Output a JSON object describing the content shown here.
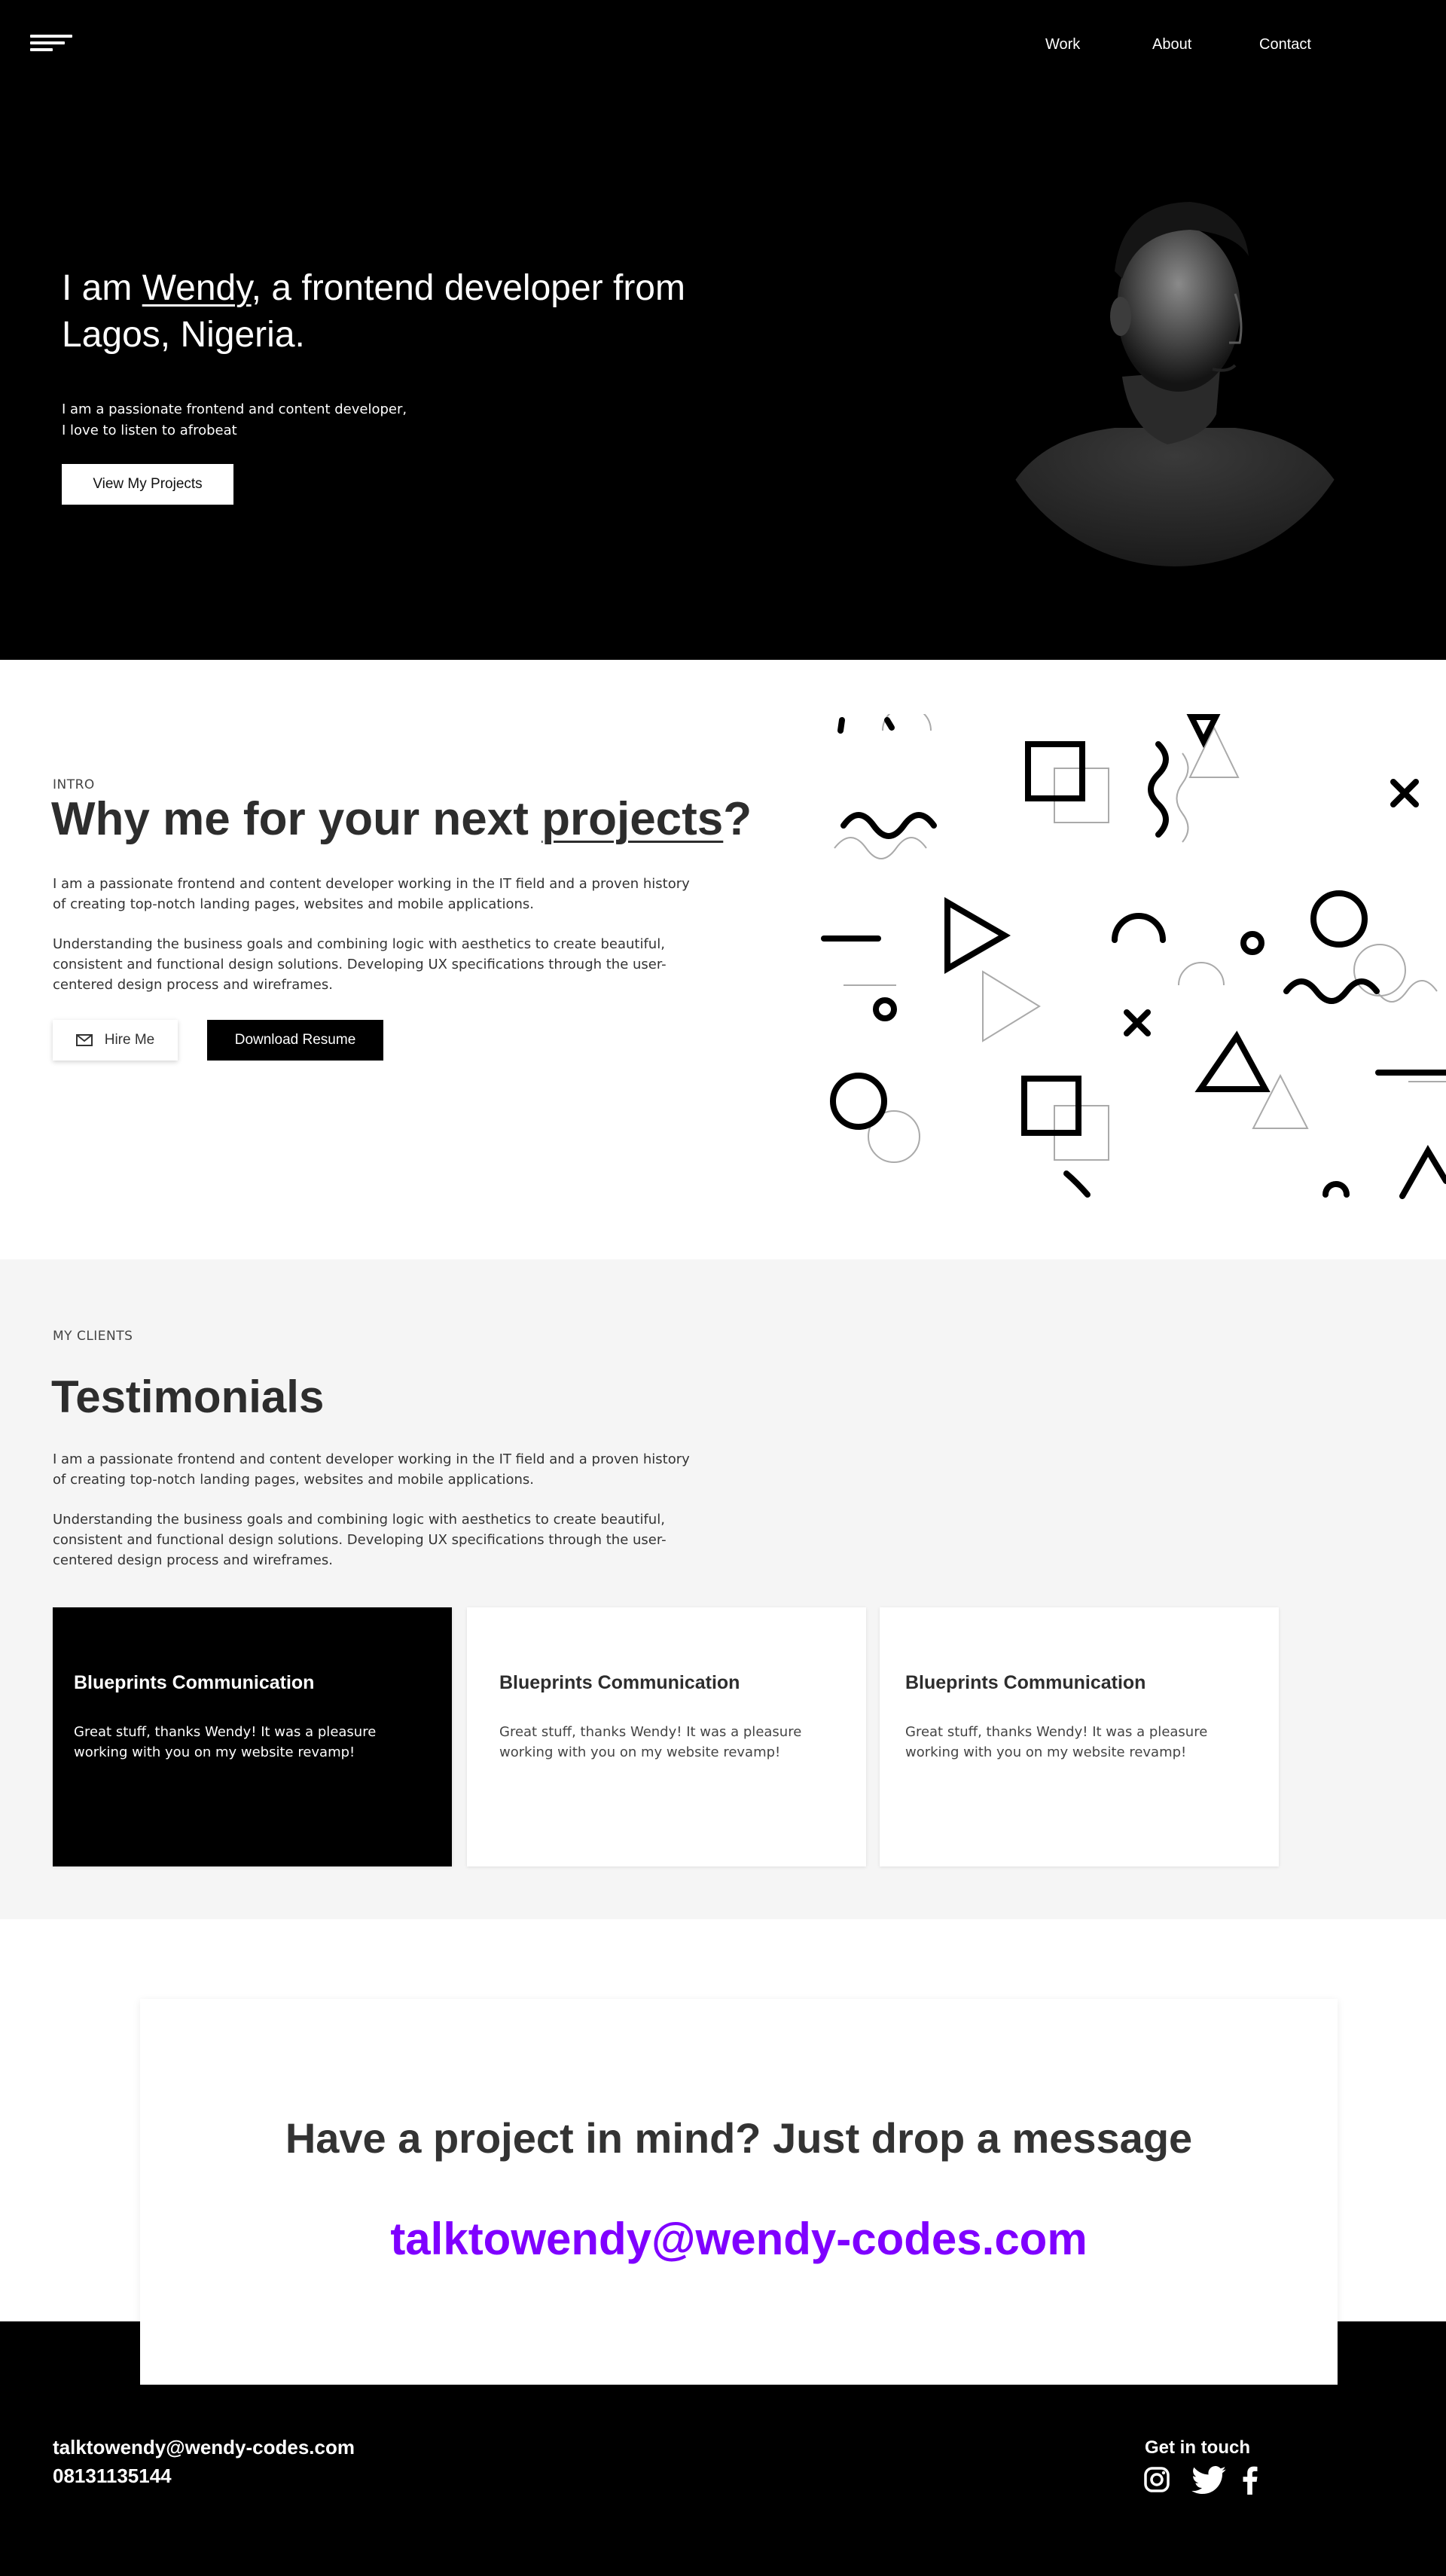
{
  "header": {
    "nav": [
      "Work",
      "About",
      "Contact"
    ]
  },
  "hero": {
    "title_pre": "I am ",
    "name": "Wendy",
    "title_post": ", a frontend developer from Lagos, Nigeria.",
    "sub_line1": "I am a passionate frontend and content developer,",
    "sub_line2": "I love to listen to afrobeat",
    "cta": "View My Projects"
  },
  "intro": {
    "eyebrow": "INTRO",
    "title_pre": "Why me for your next ",
    "title_link": "projects",
    "title_post": "?",
    "para1": "I am a passionate frontend and content developer working in the IT field and a proven history of creating top-notch landing pages, websites and mobile applications.",
    "para2": "Understanding the business goals and combining logic with aesthetics to create beautiful, consistent and functional design solutions. Developing UX specifications through the user-centered design process and wireframes.",
    "hire_label": "Hire Me",
    "resume_label": "Download Resume"
  },
  "testimonials": {
    "eyebrow": "MY CLIENTS",
    "title": "Testimonials",
    "para1": "I am a passionate frontend and content developer working in the IT field and a proven history of creating top-notch landing pages, websites and mobile applications.",
    "para2": "Understanding the business goals and combining logic with aesthetics to create beautiful, consistent and functional design solutions. Developing UX specifications through the user-centered design process and wireframes.",
    "cards": [
      {
        "title": "Blueprints Communication",
        "text": "Great stuff, thanks Wendy! It was a pleasure working with you on my website revamp!"
      },
      {
        "title": "Blueprints Communication",
        "text": "Great stuff, thanks Wendy! It was a pleasure working with you on my website revamp!"
      },
      {
        "title": "Blueprints Communication",
        "text": "Great stuff, thanks Wendy! It was a pleasure working with you on my website revamp!"
      }
    ]
  },
  "contact": {
    "title": "Have a project in mind? Just drop a message",
    "email": "talktowendy@wendy-codes.com",
    "accent_color": "#7f00ff"
  },
  "footer": {
    "email": "talktowendy@wendy-codes.com",
    "phone": "08131135144",
    "get_in_touch": "Get in touch",
    "socials": [
      "instagram-icon",
      "twitter-icon",
      "facebook-icon"
    ]
  }
}
